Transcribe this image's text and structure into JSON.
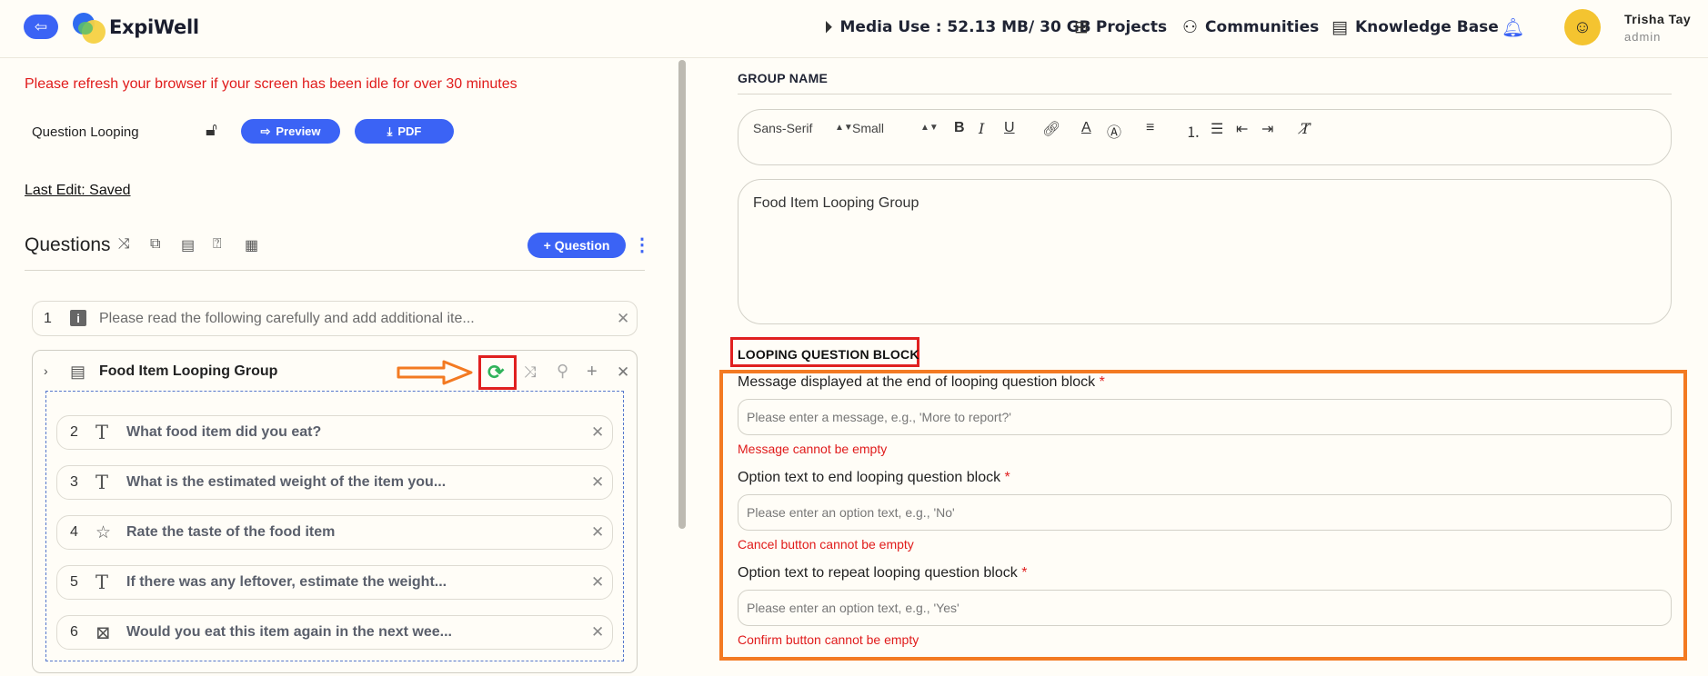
{
  "header": {
    "brand": "ExpiWell",
    "media_use": "Media Use : 52.13 MB/ 30 GB",
    "projects": "Projects",
    "communities": "Communities",
    "knowledge_base": "Knowledge Base",
    "user_name": "Trisha Tay",
    "user_role": "admin"
  },
  "left": {
    "refresh_notice": "Please refresh your browser if your screen has been idle for over 30 minutes",
    "survey_name": "Question Looping",
    "preview_label": "Preview",
    "pdf_label": "PDF",
    "last_edit": "Last Edit: Saved",
    "questions_title": "Questions",
    "add_question_label": "Question",
    "questions": [
      {
        "num": "1",
        "text": "Please read the following carefully and add additional ite..."
      }
    ],
    "group": {
      "title": "Food Item Looping Group",
      "items": [
        {
          "num": "2",
          "icon": "T",
          "text": "What food item did you eat?"
        },
        {
          "num": "3",
          "icon": "T",
          "text": "What is the estimated weight of the item you..."
        },
        {
          "num": "4",
          "icon": "☆",
          "text": "Rate the taste of the food item"
        },
        {
          "num": "5",
          "icon": "T",
          "text": "If there was any leftover, estimate the weight..."
        },
        {
          "num": "6",
          "icon": "⊠",
          "text": "Would you eat this item again in the next wee..."
        }
      ]
    }
  },
  "right": {
    "group_name_label": "GROUP NAME",
    "font_select": "Sans-Serif",
    "size_select": "Small",
    "group_name_value": "Food Item Looping Group",
    "looping_label": "LOOPING QUESTION BLOCK",
    "fields": [
      {
        "label": "Message displayed at the end of looping question block",
        "placeholder": "Please enter a message, e.g., 'More to report?'",
        "error": "Message cannot be empty"
      },
      {
        "label": "Option text to end looping question block",
        "placeholder": "Please enter an option text, e.g., 'No'",
        "error": "Cancel button cannot be empty"
      },
      {
        "label": "Option text to repeat looping question block",
        "placeholder": "Please enter an option text, e.g., 'Yes'",
        "error": "Confirm button cannot be empty"
      }
    ]
  },
  "colors": {
    "accent": "#3b63f5",
    "error": "#e01b1b",
    "highlight_red": "#e02020",
    "highlight_orange": "#f37a22",
    "sync_green": "#2fb35a"
  }
}
